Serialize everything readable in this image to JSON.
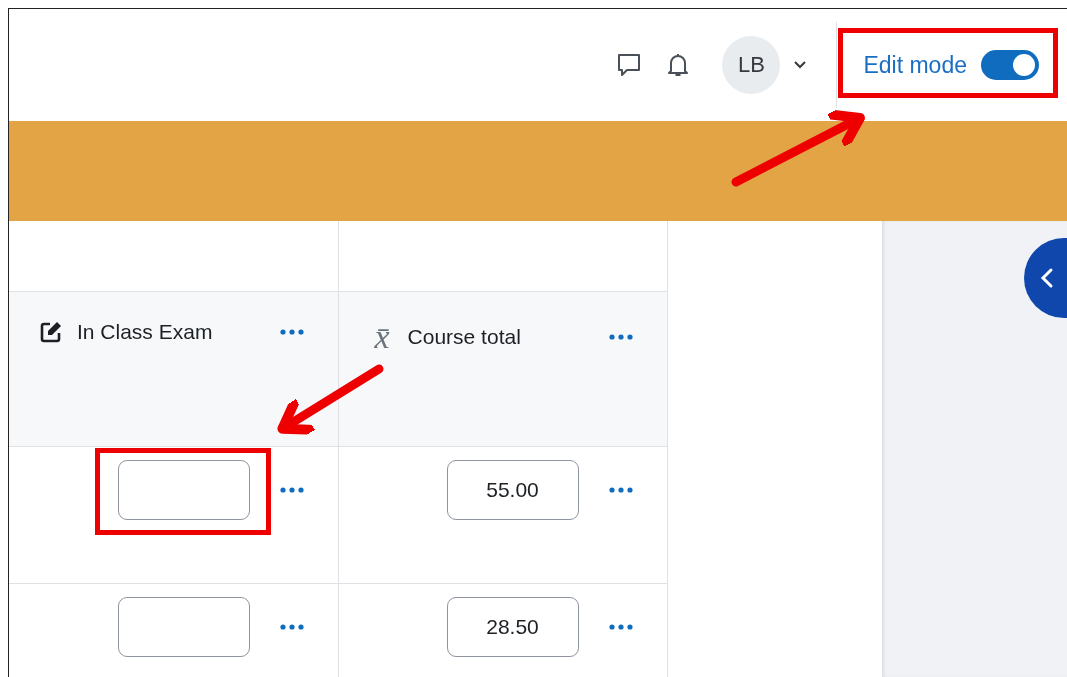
{
  "header": {
    "avatar_initials": "LB",
    "edit_mode": {
      "label": "Edit mode",
      "on": true
    }
  },
  "grader_table": {
    "columns": [
      {
        "kind": "manual",
        "label": "In Class Exam"
      },
      {
        "kind": "calculated",
        "symbol": "x̄",
        "label": "Course total"
      }
    ],
    "rows": [
      {
        "cells": [
          {
            "kind": "input"
          },
          {
            "kind": "input",
            "value": "55.00"
          }
        ]
      },
      {
        "cells": [
          {
            "kind": "input"
          },
          {
            "kind": "input",
            "value": "28.50"
          }
        ]
      }
    ]
  }
}
